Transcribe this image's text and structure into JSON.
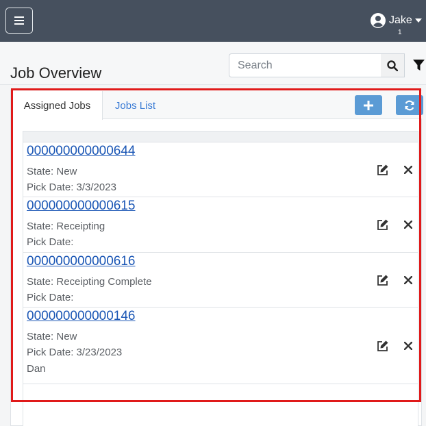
{
  "topbar": {
    "user_name": "Jake",
    "user_count": "1"
  },
  "page": {
    "title": "Job Overview"
  },
  "search": {
    "placeholder": "Search",
    "value": ""
  },
  "tabs": [
    {
      "label": "Assigned Jobs",
      "active": true
    },
    {
      "label": "Jobs List",
      "active": false
    }
  ],
  "colors": {
    "topbar": "#46505e",
    "accent_button": "#5b9bd5",
    "link": "#1a56b5",
    "highlight_border": "#e01a1a"
  },
  "icons": [
    "hamburger-icon",
    "user-circle-icon",
    "search-icon",
    "filter-icon",
    "plus-icon",
    "refresh-icon",
    "edit-icon",
    "close-icon"
  ],
  "jobs": [
    {
      "id": "000000000000644",
      "state": "State: New",
      "pick_date": "Pick Date: 3/3/2023",
      "extra": ""
    },
    {
      "id": "000000000000615",
      "state": "State: Receipting",
      "pick_date": "Pick Date:",
      "extra": ""
    },
    {
      "id": "000000000000616",
      "state": "State: Receipting Complete",
      "pick_date": "Pick Date:",
      "extra": ""
    },
    {
      "id": "000000000000146",
      "state": "State: New",
      "pick_date": "Pick Date: 3/23/2023",
      "extra": "Dan"
    }
  ]
}
